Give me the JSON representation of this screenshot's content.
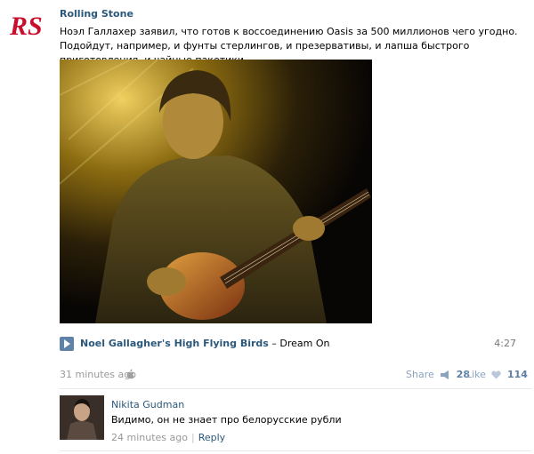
{
  "post": {
    "author": "Rolling Stone",
    "logo_text": "RS",
    "text": "Ноэл Галлахер заявил, что готов к воссоединению Oasis за 500 миллионов чего угодно. Подойдут, например, и фунты стерлингов, и презервативы, и лапша быстрого приготовления, и чайные пакетики.",
    "time": "31 minutes ago",
    "share_label": "Share",
    "share_count": "28",
    "like_label": "Like",
    "like_count": "114"
  },
  "audio": {
    "artist": "Noel Gallagher's High Flying Birds",
    "separator": " – ",
    "title": "Dream On",
    "duration": "4:27"
  },
  "comment": {
    "author": "Nikita Gudman",
    "text": "Видимо, он не знает про белорусские рубли",
    "time": "24 minutes ago",
    "pipe": "|",
    "reply_label": "Reply"
  },
  "icons": {
    "play": "play-icon",
    "apple": "apple-icon",
    "share": "megaphone-icon",
    "like": "heart-icon"
  },
  "colors": {
    "link": "#2b587a",
    "logo_red": "#c8102e",
    "muted": "#999999"
  }
}
